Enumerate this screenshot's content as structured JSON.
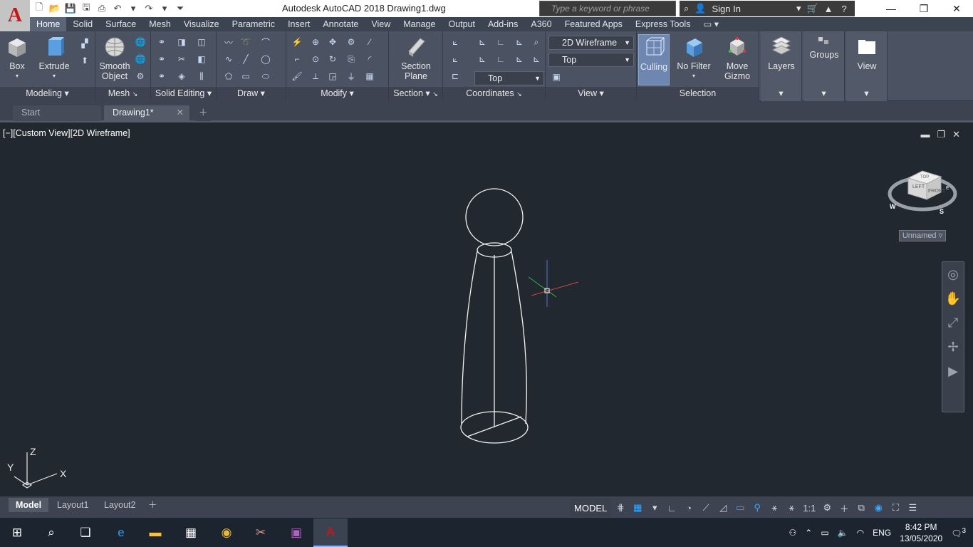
{
  "window": {
    "title": "Autodesk AutoCAD 2018    Drawing1.dwg",
    "search_placeholder": "Type a keyword or phrase",
    "sign_in": "Sign In"
  },
  "ribbon_tabs": [
    "Home",
    "Solid",
    "Surface",
    "Mesh",
    "Visualize",
    "Parametric",
    "Insert",
    "Annotate",
    "View",
    "Manage",
    "Output",
    "Add-ins",
    "A360",
    "Featured Apps",
    "Express Tools"
  ],
  "active_tab": "Home",
  "panels": {
    "modeling": {
      "title": "Modeling",
      "box": "Box",
      "extrude": "Extrude"
    },
    "mesh": {
      "title": "Mesh",
      "smooth_line1": "Smooth",
      "smooth_line2": "Object"
    },
    "solid_editing": {
      "title": "Solid Editing"
    },
    "draw": {
      "title": "Draw"
    },
    "modify": {
      "title": "Modify"
    },
    "section": {
      "title": "Section",
      "plane_line1": "Section",
      "plane_line2": "Plane"
    },
    "coordinates": {
      "title": "Coordinates"
    },
    "view": {
      "title": "View",
      "visual_style": "2D Wireframe",
      "view_name": "Top",
      "named_view": "Top"
    },
    "selection": {
      "title": "Selection",
      "culling": "Culling",
      "no_filter": "No Filter",
      "move_line1": "Move",
      "move_line2": "Gizmo"
    },
    "layers": {
      "label": "Layers"
    },
    "groups": {
      "label": "Groups"
    },
    "viewpanel": {
      "label": "View"
    }
  },
  "file_tabs": {
    "start": "Start",
    "drawing": "Drawing1*"
  },
  "viewport": {
    "label": "[−][Custom View][2D Wireframe]",
    "viewcube_unnamed": "Unnamed",
    "cube_front": "FRONT",
    "cube_left": "LEFT",
    "cube_top": "TOP",
    "compass_w": "W",
    "compass_s": "S",
    "compass_e": "E",
    "ucs_x": "X",
    "ucs_y": "Y",
    "ucs_z": "Z"
  },
  "layout_tabs": [
    "Model",
    "Layout1",
    "Layout2"
  ],
  "status": {
    "model": "MODEL",
    "scale": "1:1"
  },
  "taskbar": {
    "lang": "ENG",
    "time": "8:42 PM",
    "date": "13/05/2020",
    "notifications": "3"
  },
  "colors": {
    "viewport_bg": "#212830",
    "ribbon_bg": "#4b5261",
    "accent": "#3aa7ff"
  }
}
